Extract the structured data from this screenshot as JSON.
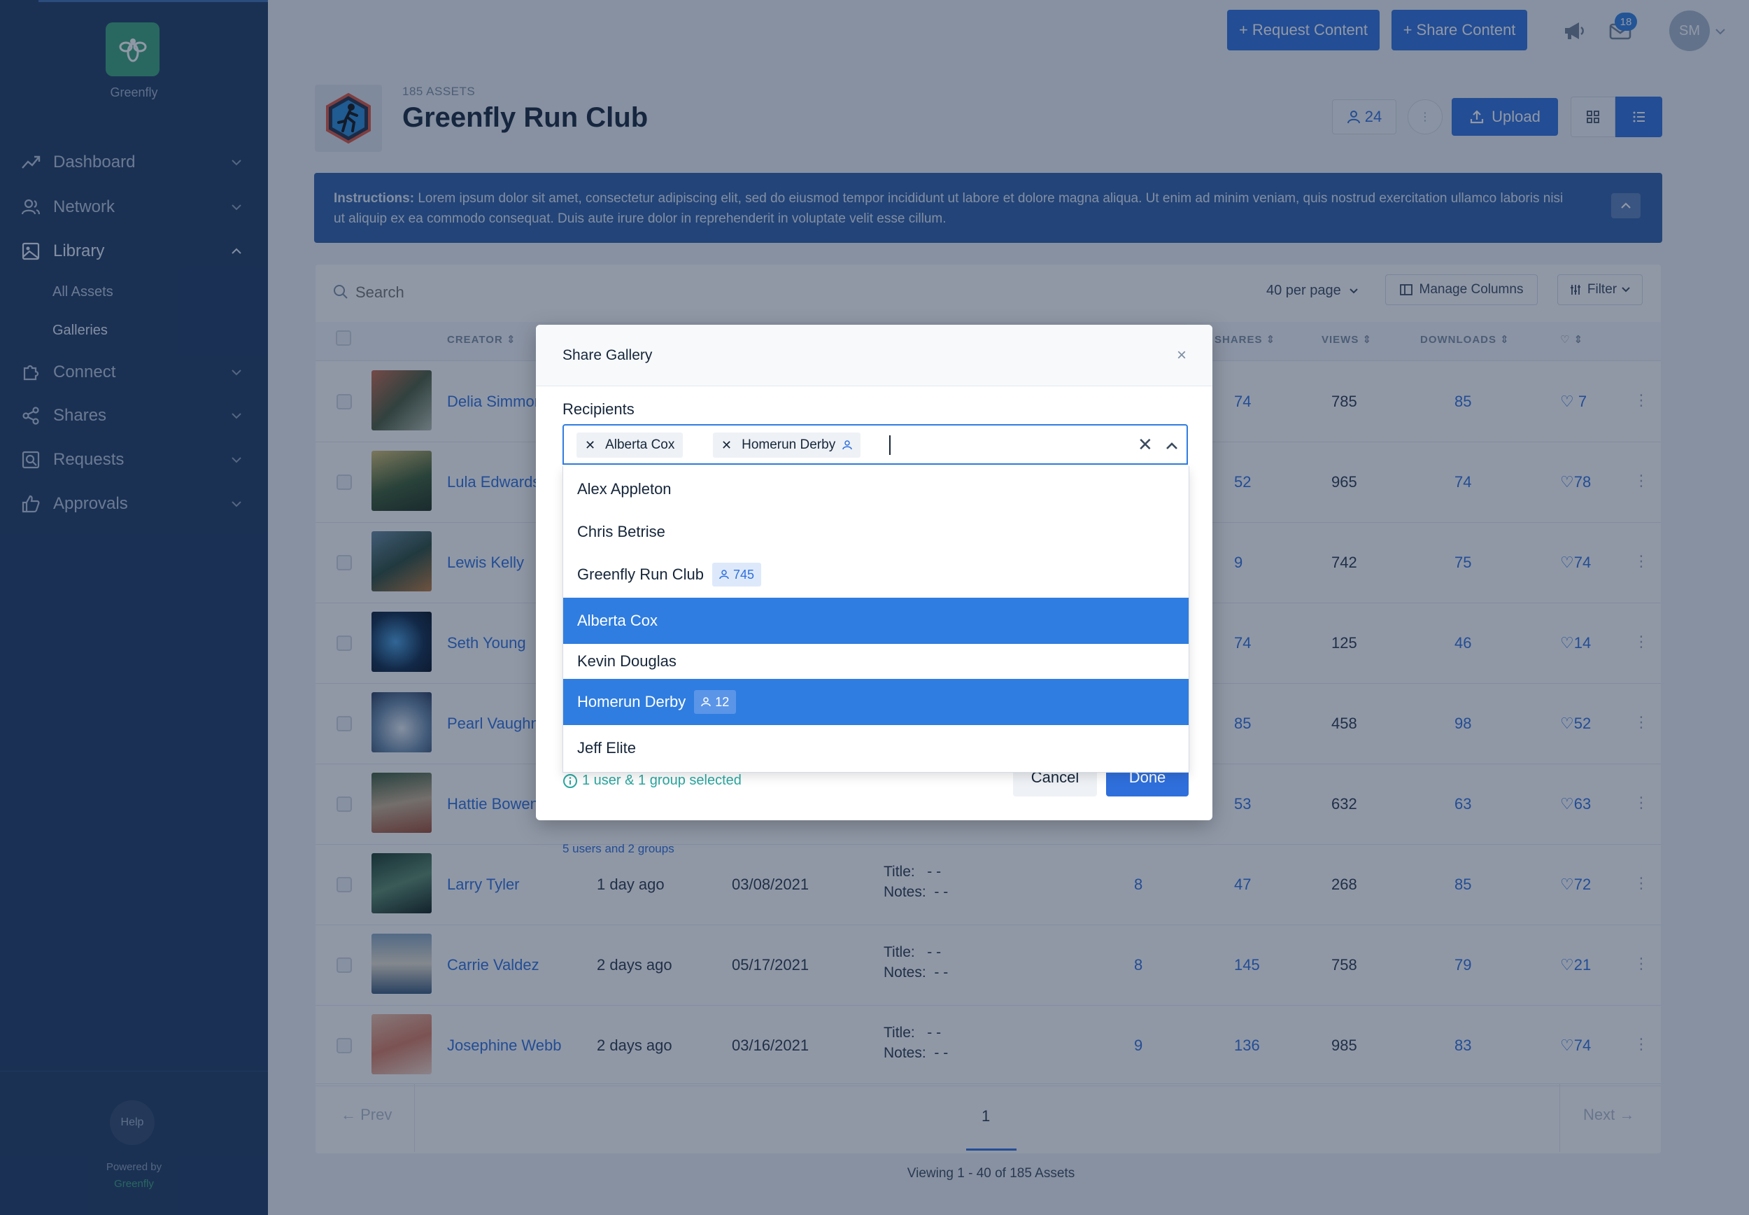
{
  "sidebar": {
    "brand": "Greenfly",
    "nav": [
      {
        "label": "Dashboard",
        "icon": "trend-icon"
      },
      {
        "label": "Network",
        "icon": "users-icon"
      },
      {
        "label": "Library",
        "icon": "image-icon"
      },
      {
        "label": "Connect",
        "icon": "puzzle-icon"
      },
      {
        "label": "Shares",
        "icon": "share-icon"
      },
      {
        "label": "Requests",
        "icon": "request-icon"
      },
      {
        "label": "Approvals",
        "icon": "thumbs-up-icon"
      }
    ],
    "library_sub": [
      "All Assets",
      "Galleries"
    ],
    "help": "Help",
    "powered_by": "Powered by",
    "powered_brand": "Greenfly"
  },
  "topbar": {
    "request_content": "+ Request Content",
    "share_content": "+ Share Content",
    "inbox_count": "18",
    "avatar_initials": "SM"
  },
  "gallery": {
    "asset_count": "185 ASSETS",
    "title": "Greenfly Run Club",
    "members": "24",
    "upload": "Upload"
  },
  "instructions": {
    "label": "Instructions:",
    "text": "Lorem ipsum dolor sit amet, consectetur adipiscing elit, sed do eiusmod tempor incididunt ut labore et dolore magna aliqua. Ut enim ad minim veniam, quis nostrud exercitation ullamco laboris nisi ut aliquip ex ea commodo consequat. Duis aute irure dolor in reprehenderit in voluptate velit esse cillum."
  },
  "toolbar": {
    "search_placeholder": "Search",
    "per_page": "40 per page",
    "manage_columns": "Manage Columns",
    "filter": "Filter"
  },
  "table": {
    "headers": {
      "creator": "CREATOR",
      "shares": "SHARES",
      "views": "VIEWS",
      "downloads": "DOWNLOADS"
    },
    "rows": [
      {
        "creator": "Delia Simmons",
        "creator_visible": "Delia Simmor",
        "shares": "74",
        "views": "785",
        "downloads": "85",
        "likes": "7"
      },
      {
        "creator": "Lula Edwards",
        "creator_visible": "Lula Edwards",
        "shares": "52",
        "views": "965",
        "downloads": "74",
        "likes": "78"
      },
      {
        "creator": "Lewis Kelly",
        "creator_visible": "Lewis Kelly",
        "shares": "9",
        "views": "742",
        "downloads": "75",
        "likes": "74"
      },
      {
        "creator": "Seth Young",
        "creator_visible": "Seth Young",
        "shares": "74",
        "views": "125",
        "downloads": "46",
        "likes": "14"
      },
      {
        "creator": "Pearl Vaughn",
        "creator_visible": "Pearl Vaughn",
        "shares": "85",
        "views": "458",
        "downloads": "98",
        "likes": "52"
      },
      {
        "creator": "Hattie Bowen",
        "creator_visible": "Hattie Bowen",
        "shares": "53",
        "views": "632",
        "downloads": "63",
        "likes": "63"
      },
      {
        "creator": "Larry Tyler",
        "creator_visible": "Larry Tyler",
        "time": "1 day ago",
        "date": "03/08/2021",
        "title": "- -",
        "notes": "- -",
        "n1": "8",
        "shares": "47",
        "views": "268",
        "downloads": "85",
        "likes": "72"
      },
      {
        "creator": "Carrie Valdez",
        "creator_visible": "Carrie Valdez",
        "time": "2 days ago",
        "date": "05/17/2021",
        "title": "- -",
        "notes": "- -",
        "n1": "8",
        "shares": "145",
        "views": "758",
        "downloads": "79",
        "likes": "21"
      },
      {
        "creator": "Josephine Webb",
        "creator_visible": "Josephine Webb",
        "time": "2 days ago",
        "date": "03/16/2021",
        "title": "- -",
        "notes": "- -",
        "n1": "9",
        "shares": "136",
        "views": "985",
        "downloads": "83",
        "likes": "74"
      }
    ],
    "title_label": "Title:",
    "notes_label": "Notes:",
    "users_groups_note": "5 users and 2 groups"
  },
  "pagination": {
    "prev": "Prev",
    "next": "Next",
    "page": "1",
    "viewing": "Viewing 1 - 40 of 185 Assets"
  },
  "modal": {
    "title": "Share Gallery",
    "recipients_label": "Recipients",
    "chips": [
      "Alberta Cox",
      "Homerun Derby"
    ],
    "options": [
      {
        "label": "Alex Appleton",
        "selected": false
      },
      {
        "label": "Chris Betrise",
        "selected": false
      },
      {
        "label": "Greenfly Run Club",
        "count": "745",
        "selected": false
      },
      {
        "label": "Alberta Cox",
        "selected": true
      },
      {
        "label": "Kevin Douglas",
        "selected": false
      },
      {
        "label": "Homerun Derby",
        "count": "12",
        "selected": true
      },
      {
        "label": "Jeff Elite",
        "selected": false
      }
    ],
    "selected_info": "1 user & 1 group selected",
    "cancel": "Cancel",
    "done": "Done"
  }
}
